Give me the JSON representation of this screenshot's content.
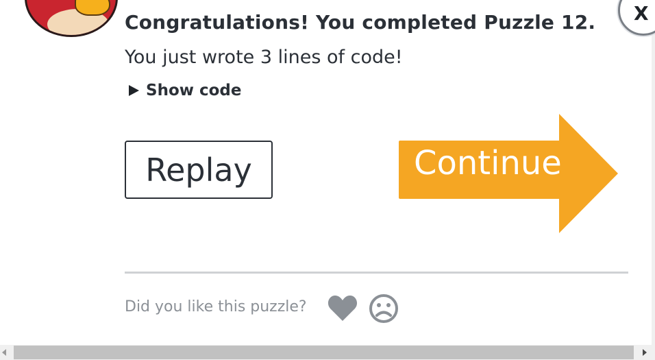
{
  "dialog": {
    "title": "Congratulations! You completed Puzzle 12.",
    "subtitle": "You just wrote 3 lines of code!",
    "show_code_label": "Show code",
    "close_label": "X"
  },
  "actions": {
    "replay_label": "Replay",
    "continue_label": "Continue",
    "continue_color": "#f5a623"
  },
  "feedback": {
    "prompt": "Did you like this puzzle?",
    "like_icon": "heart-icon",
    "dislike_icon": "frown-icon",
    "icon_color": "#8b9096"
  }
}
